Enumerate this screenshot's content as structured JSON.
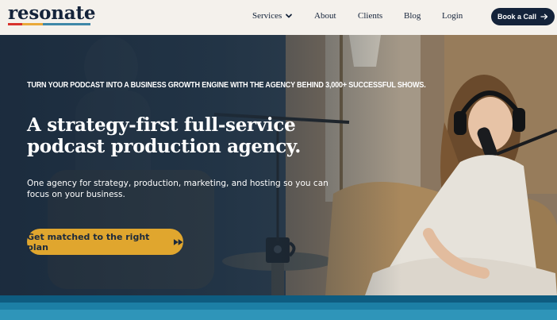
{
  "brand": {
    "name": "resonate",
    "colors": {
      "red": "#d8322c",
      "gold": "#e9a93a",
      "blue": "#3f88a8",
      "navy": "#14233a"
    }
  },
  "nav": {
    "items": [
      {
        "label": "Services",
        "has_dropdown": true,
        "icon": "chevron-down-icon"
      },
      {
        "label": "About"
      },
      {
        "label": "Clients"
      },
      {
        "label": "Blog"
      },
      {
        "label": "Login"
      }
    ],
    "cta": {
      "label": "Book a Call",
      "icon": "arrow-right-icon"
    }
  },
  "hero": {
    "eyebrow": "Turn your podcast into a business growth engine with the agency behind 3,000+ successful shows.",
    "headline": "A strategy-first full-service podcast production agency.",
    "subtext": "One agency for strategy, production, marketing, and hosting so you can focus on your business.",
    "cta": {
      "label": "Get matched to the right plan",
      "icon": "fast-forward-icon",
      "color": "#e0a62e"
    }
  },
  "stripes": {
    "colors": [
      "#0e5c80",
      "#1c7fa5",
      "#2f95b9"
    ]
  }
}
